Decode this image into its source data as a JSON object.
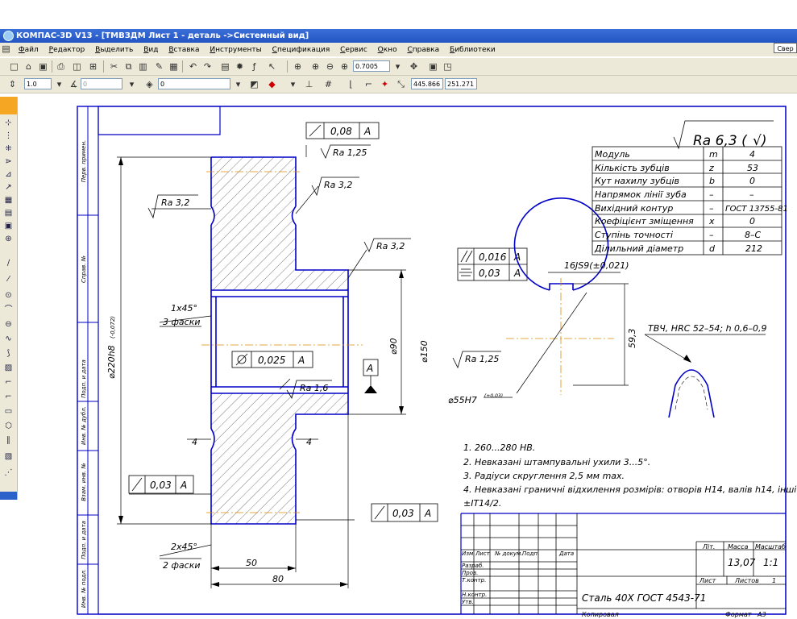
{
  "window": {
    "title": "КОМПАС-3D V13 - [ТМВЗДМ Лист 1 - деталь ->Системный вид]",
    "right_button": "Свер"
  },
  "menu": [
    "Файл",
    "Редактор",
    "Выделить",
    "Вид",
    "Вставка",
    "Инструменты",
    "Спецификация",
    "Сервис",
    "Окно",
    "Справка",
    "Библиотеки"
  ],
  "toolbar": {
    "zoom": "0.7005",
    "line_step": "1.0",
    "angle_step": "0",
    "layer": "0",
    "coord_x": "445.866",
    "coord_y": "251.271"
  },
  "drawing": {
    "roughness_main": "Ra 6,3 (",
    "roughness_labels": [
      "Ra 1,25",
      "Ra 3,2",
      "Ra 3,2",
      "Ra 3,2",
      "Ra 1,6",
      "Ra 1,25"
    ],
    "tolerance_frames": [
      {
        "value": "0,08",
        "base": "A"
      },
      {
        "value": "0,025",
        "base": "A"
      },
      {
        "value": "0,03",
        "base": "A"
      },
      {
        "value": "0,03",
        "base": "A"
      },
      {
        "value": "0,016",
        "base": "A"
      },
      {
        "value": "0,03",
        "base": "A"
      }
    ],
    "datum": "A",
    "dims": {
      "d220": "⌀220h8",
      "d220_tol": "(-0,072)",
      "d90": "⌀90",
      "d150": "⌀150",
      "chamfer1": "1x45°",
      "chamfer1_note": "3 фаски",
      "chamfer2": "2x45°",
      "chamfer2_note": "2 фаски",
      "d50": "50",
      "d80": "80",
      "d4a": "4",
      "d4b": "4",
      "keyway": "16JS9(±0,021)",
      "key_depth": "59,3",
      "bore": "⌀55H7",
      "bore_tol": "(+0,03)",
      "hardening": "ТВЧ, HRC 52–54; h 0,6–0,9"
    },
    "params_table": [
      [
        "Модуль",
        "m",
        "4"
      ],
      [
        "Кількість зубців",
        "z",
        "53"
      ],
      [
        "Кут нахилу зубців",
        "b",
        "0"
      ],
      [
        "Напрямок лінії зуба",
        "–",
        "–"
      ],
      [
        "Вихідний контур",
        "–",
        "ГОСТ 13755-81"
      ],
      [
        "Коефіцієнт зміщення",
        "x",
        "0"
      ],
      [
        "Ступінь точності",
        "–",
        "8–С"
      ],
      [
        "Ділильний діаметр",
        "d",
        "212"
      ]
    ],
    "notes": [
      "1. 260...280 НВ.",
      "2. Невказані штампувальні ухили 3...5°.",
      "3. Радіуси скруглення 2,5 мм max.",
      "4. Невказані граничні відхилення розмірів: отворів H14, валів h14, інші",
      "±IT14/2."
    ],
    "title_block": {
      "lit": "Літ.",
      "mass": "Масса",
      "scale": "Масштаб",
      "mass_value": "13,07",
      "scale_value": "1:1",
      "sheet": "Лист",
      "sheets": "Листов",
      "sheets_value": "1",
      "material": "Сталь 40Х ГОСТ 4543-71",
      "copied": "Копировал",
      "format": "Формат",
      "format_value": "А3",
      "cols": [
        "Изм",
        "Лист",
        "№ докум.",
        "Подп.",
        "Дата"
      ],
      "rows": [
        "Разраб.",
        "Пров.",
        "Т.контр.",
        "Н.контр.",
        "Утв."
      ]
    },
    "left_strip": [
      "Перв. примен.",
      "Справ. №",
      "Подп. и дата",
      "Инв. № дубл.",
      "Взам. инв. №",
      "Подп. и дата",
      "Инв. № подл."
    ]
  }
}
